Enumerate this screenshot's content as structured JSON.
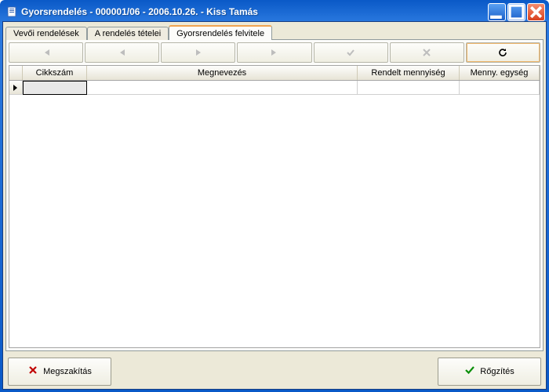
{
  "window": {
    "title": "Gyorsrendelés  -  000001/06  -  2006.10.26.  -  Kiss Tamás"
  },
  "tabs": [
    {
      "label": "Vevői rendelések",
      "active": false
    },
    {
      "label": "A rendelés tételei",
      "active": false
    },
    {
      "label": "Gyorsrendelés felvitele",
      "active": true
    }
  ],
  "grid": {
    "columns": {
      "cikkszam": "Cikkszám",
      "megnevezes": "Megnevezés",
      "rendelt_mennyiseg": "Rendelt mennyiség",
      "menny_egyseg": "Menny. egység"
    }
  },
  "buttons": {
    "cancel": "Megszakítás",
    "save": "Rőgzítés"
  }
}
